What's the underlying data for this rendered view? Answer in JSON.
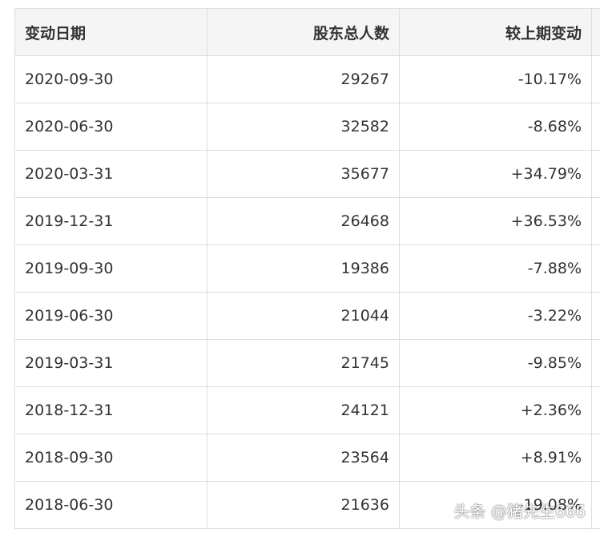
{
  "table": {
    "headers": {
      "date": "变动日期",
      "holders": "股东总人数",
      "change": "较上期变动"
    },
    "rows": [
      {
        "date": "2020-09-30",
        "holders": "29267",
        "change": "-10.17%",
        "direction": "down"
      },
      {
        "date": "2020-06-30",
        "holders": "32582",
        "change": "-8.68%",
        "direction": "down"
      },
      {
        "date": "2020-03-31",
        "holders": "35677",
        "change": "+34.79%",
        "direction": "up"
      },
      {
        "date": "2019-12-31",
        "holders": "26468",
        "change": "+36.53%",
        "direction": "up"
      },
      {
        "date": "2019-09-30",
        "holders": "19386",
        "change": "-7.88%",
        "direction": "down"
      },
      {
        "date": "2019-06-30",
        "holders": "21044",
        "change": "-3.22%",
        "direction": "down"
      },
      {
        "date": "2019-03-31",
        "holders": "21745",
        "change": "-9.85%",
        "direction": "down"
      },
      {
        "date": "2018-12-31",
        "holders": "24121",
        "change": "+2.36%",
        "direction": "up"
      },
      {
        "date": "2018-09-30",
        "holders": "23564",
        "change": "+8.91%",
        "direction": "up"
      },
      {
        "date": "2018-06-30",
        "holders": "21636",
        "change": "-19.08%",
        "direction": "down"
      }
    ]
  },
  "colors": {
    "up": "#c9302c",
    "down": "#259b3c",
    "header_bg": "#f5f5f5",
    "border": "#dddddd"
  },
  "watermark": "头条 @猪先生666"
}
